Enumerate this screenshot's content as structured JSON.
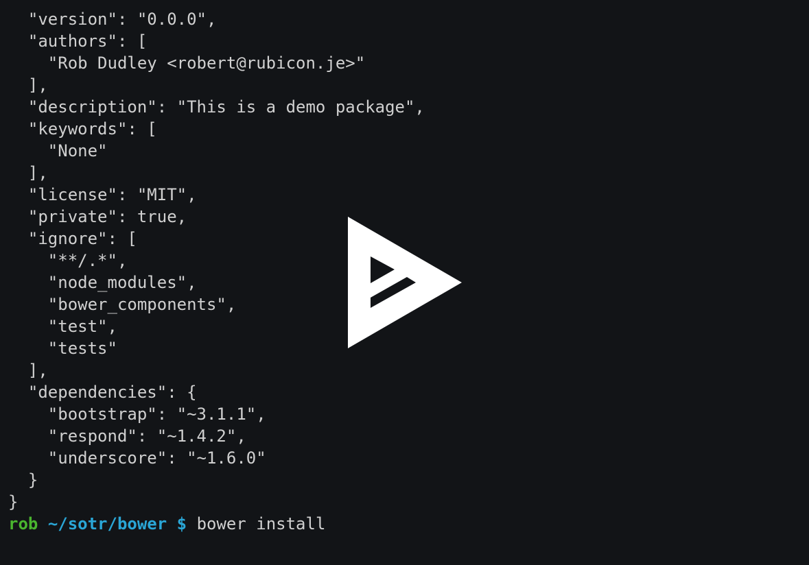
{
  "terminal": {
    "lines": [
      "  \"version\": \"0.0.0\",",
      "  \"authors\": [",
      "    \"Rob Dudley <robert@rubicon.je>\"",
      "  ],",
      "  \"description\": \"This is a demo package\",",
      "  \"keywords\": [",
      "    \"None\"",
      "  ],",
      "  \"license\": \"MIT\",",
      "  \"private\": true,",
      "  \"ignore\": [",
      "    \"**/.*\",",
      "    \"node_modules\",",
      "    \"bower_components\",",
      "    \"test\",",
      "    \"tests\"",
      "  ],",
      "  \"dependencies\": {",
      "    \"bootstrap\": \"~3.1.1\",",
      "    \"respond\": \"~1.4.2\",",
      "    \"underscore\": \"~1.6.0\"",
      "  }",
      "}"
    ],
    "prompt": {
      "user": "rob",
      "path": "~/sotr/bower",
      "symbol": "$",
      "command": "bower install"
    }
  },
  "overlay": {
    "icon": "asciinema-play-icon",
    "color": "#ffffff"
  },
  "colors": {
    "background": "#121417",
    "text": "#d0d0d0",
    "user": "#4ab52f",
    "path": "#2aa6d6"
  }
}
